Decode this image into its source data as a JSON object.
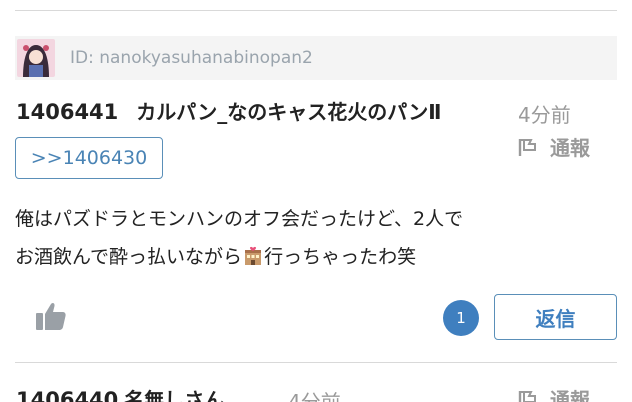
{
  "post": {
    "user_id": "ID: nanokyasuhanabinopan2",
    "number": "1406441",
    "name": "カルパン_なのキャス花火のパンⅡ",
    "time": "4分前",
    "report_label": "通報",
    "anchor": ">>1406430",
    "body_line1": "俺はパズドラとモンハンのオフ会だったけど、2人で",
    "body_line2_before": "お酒飲んで酔っ払いながら",
    "body_line2_after": "行っちゃったわ笑",
    "reply_count": "1",
    "reply_label": "返信",
    "like_icon": "thumbs-up-icon",
    "emoji_icon": "love-hotel-emoji"
  },
  "next_post": {
    "number": "1406440",
    "name": "名無しさん",
    "time": "4分前",
    "report_label": "通報"
  },
  "colors": {
    "accent": "#3f7fbf",
    "border": "#5a8fb8",
    "muted": "#9a9a9a",
    "id_bg": "#f4f4f4"
  }
}
